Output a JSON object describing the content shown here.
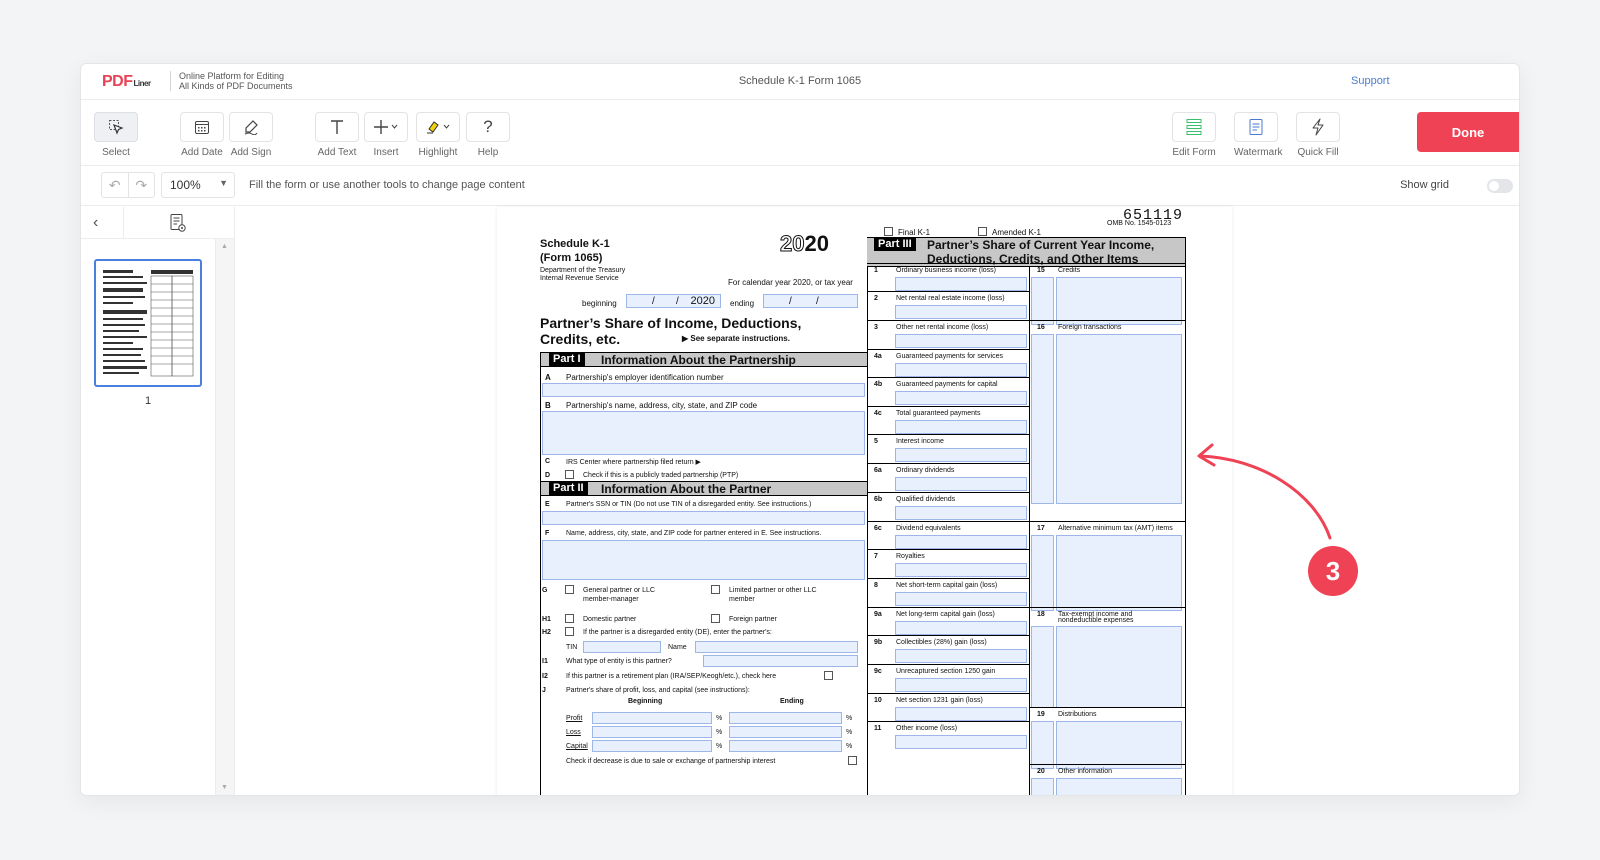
{
  "header": {
    "logo_main": "PDF",
    "logo_sub": "Liner",
    "tagline_1": "Online Platform for Editing",
    "tagline_2": "All Kinds of PDF Documents",
    "title": "Schedule K-1 Form 1065",
    "support": "Support"
  },
  "toolbar": {
    "select": "Select",
    "add_date": "Add Date",
    "add_sign": "Add Sign",
    "add_text": "Add Text",
    "insert": "Insert",
    "highlight": "Highlight",
    "help": "Help",
    "edit_form": "Edit Form",
    "watermark": "Watermark",
    "quick_fill": "Quick Fill",
    "done": "Done"
  },
  "subtoolbar": {
    "zoom": "100%",
    "hint": "Fill the form or use another tools to change page content",
    "show_grid": "Show grid"
  },
  "sidebar": {
    "page_number": "1"
  },
  "form": {
    "barcode": "651119",
    "final_k1": "Final K-1",
    "amended_k1": "Amended K-1",
    "omb": "OMB No. 1545-0123",
    "schedule": "Schedule K-1",
    "form_no": "(Form 1065)",
    "dept": "Department of the Treasury",
    "irs": "Internal Revenue Service",
    "year_light": "20",
    "year_bold": "20",
    "cal_year": "For calendar year 2020, or tax year",
    "beginning": "beginning",
    "year_value": "2020",
    "ending": "ending",
    "title_1": "Partner’s Share of Income, Deductions,",
    "title_2": "Credits, etc.",
    "see_instr": "▶ See separate instructions.",
    "part1_tag": "Part I",
    "part1_title": "Information About the Partnership",
    "A": "Partnership's employer identification number",
    "B": "Partnership's name, address, city, state, and ZIP code",
    "C": "IRS Center where partnership filed return ▶",
    "D": "Check if this is a publicly traded partnership (PTP)",
    "part2_tag": "Part II",
    "part2_title": "Information About the Partner",
    "E": "Partner's SSN or TIN (Do not use TIN of a disregarded entity. See instructions.)",
    "F": "Name, address, city, state, and ZIP code for partner entered in E. See instructions.",
    "G1": "General partner or LLC",
    "G1b": "member-manager",
    "G2": "Limited partner or other LLC",
    "G2b": "member",
    "H1a": "Domestic partner",
    "H1b": "Foreign partner",
    "H2": "If the partner is a disregarded entity (DE), enter the partner's:",
    "tin": "TIN",
    "name": "Name",
    "I1": "What type of entity is this partner?",
    "I2": "If this partner is a retirement plan (IRA/SEP/Keogh/etc.), check here",
    "J": "Partner's share of profit, loss, and capital (see instructions):",
    "col_beg": "Beginning",
    "col_end": "Ending",
    "profit": "Profit",
    "loss": "Loss",
    "capital": "Capital",
    "pct": "%",
    "decrease": "Check if decrease is due to sale or exchange of partnership interest",
    "part3_tag": "Part III",
    "part3_title_1": "Partner’s Share of Current Year Income,",
    "part3_title_2": "Deductions, Credits, and Other Items",
    "left_items": [
      {
        "num": "1",
        "label": "Ordinary business income (loss)"
      },
      {
        "num": "2",
        "label": "Net rental real estate income (loss)"
      },
      {
        "num": "3",
        "label": "Other net rental income (loss)"
      },
      {
        "num": "4a",
        "label": "Guaranteed payments for services"
      },
      {
        "num": "4b",
        "label": "Guaranteed payments for capital"
      },
      {
        "num": "4c",
        "label": "Total guaranteed payments"
      },
      {
        "num": "5",
        "label": "Interest income"
      },
      {
        "num": "6a",
        "label": "Ordinary dividends"
      },
      {
        "num": "6b",
        "label": "Qualified dividends"
      },
      {
        "num": "6c",
        "label": "Dividend equivalents"
      },
      {
        "num": "7",
        "label": "Royalties"
      },
      {
        "num": "8",
        "label": "Net short-term capital gain (loss)"
      },
      {
        "num": "9a",
        "label": "Net long-term capital gain (loss)"
      },
      {
        "num": "9b",
        "label": "Collectibles (28%) gain (loss)"
      },
      {
        "num": "9c",
        "label": "Unrecaptured section 1250 gain"
      },
      {
        "num": "10",
        "label": "Net section 1231 gain (loss)"
      },
      {
        "num": "11",
        "label": "Other income (loss)"
      }
    ],
    "right_items": [
      {
        "num": "15",
        "label": "Credits"
      },
      {
        "num": "16",
        "label": "Foreign transactions"
      },
      {
        "num": "17",
        "label": "Alternative minimum tax (AMT) items"
      },
      {
        "num": "18",
        "label": "Tax-exempt income and"
      },
      {
        "num": "",
        "label": "nondeductible expenses"
      },
      {
        "num": "19",
        "label": "Distributions"
      },
      {
        "num": "20",
        "label": "Other information"
      }
    ]
  },
  "annotation": {
    "step": "3"
  },
  "colors": {
    "accent": "#ef4254",
    "field_fill": "#e8f0fe",
    "link": "#4a7bd0"
  }
}
